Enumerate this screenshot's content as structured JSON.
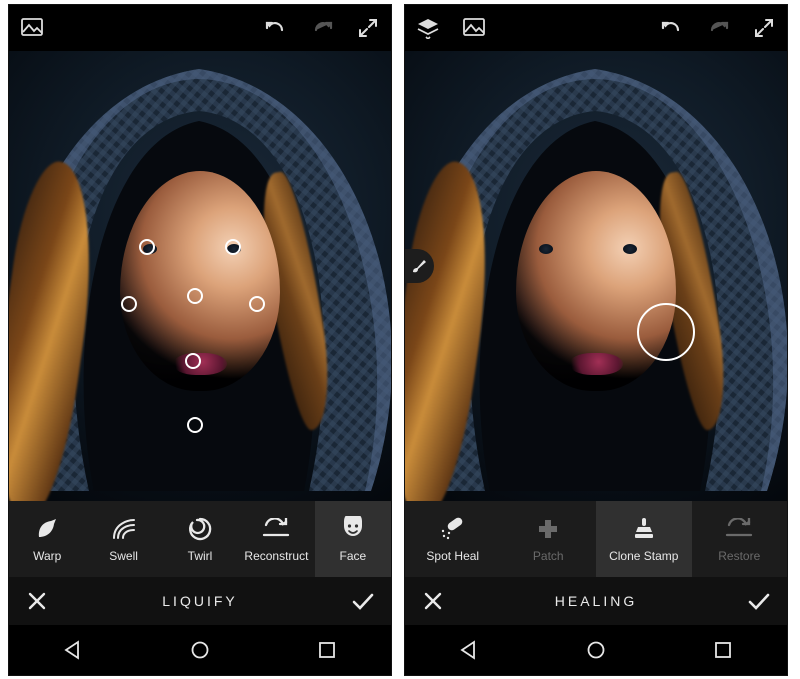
{
  "screens": [
    {
      "mode_title": "LIQUIFY",
      "tools": [
        {
          "label": "Warp",
          "id": "warp",
          "selected": false,
          "disabled": false
        },
        {
          "label": "Swell",
          "id": "swell",
          "selected": false,
          "disabled": false
        },
        {
          "label": "Twirl",
          "id": "twirl",
          "selected": false,
          "disabled": false
        },
        {
          "label": "Reconstruct",
          "id": "reconstruct",
          "selected": false,
          "disabled": false
        },
        {
          "label": "Face",
          "id": "face",
          "selected": true,
          "disabled": false
        }
      ]
    },
    {
      "mode_title": "HEALING",
      "tools": [
        {
          "label": "Spot Heal",
          "id": "spot-heal",
          "selected": false,
          "disabled": false
        },
        {
          "label": "Patch",
          "id": "patch",
          "selected": false,
          "disabled": true
        },
        {
          "label": "Clone Stamp",
          "id": "clone-stamp",
          "selected": true,
          "disabled": false
        },
        {
          "label": "Restore",
          "id": "restore",
          "selected": false,
          "disabled": true
        }
      ]
    }
  ]
}
